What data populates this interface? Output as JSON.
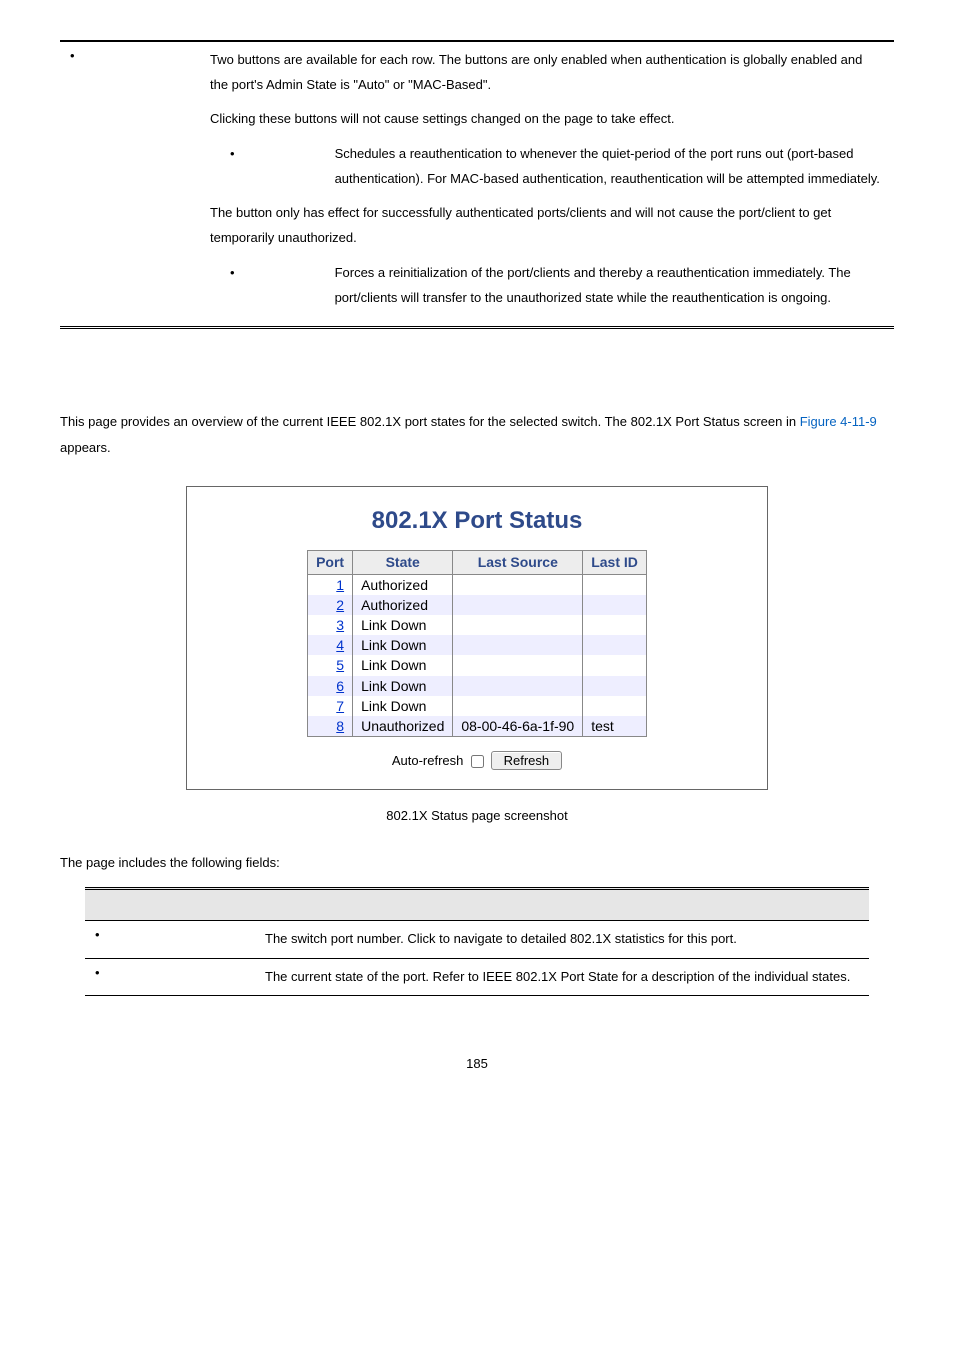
{
  "topTable": {
    "paragraphs": [
      "Two buttons are available for each row. The buttons are only enabled when authentication is globally enabled and the port's Admin State is \"Auto\" or \"MAC-Based\".",
      "Clicking these buttons will not cause settings changed on the page to take effect."
    ],
    "bullets1": [
      "Schedules a reauthentication to whenever the quiet-period of the port runs out (port-based authentication). For MAC-based authentication, reauthentication will be attempted immediately."
    ],
    "paragraphs2": [
      "The button only has effect for successfully authenticated ports/clients and will not cause the port/client to get temporarily unauthorized."
    ],
    "bullets2": [
      "Forces a reinitialization of the port/clients and thereby a reauthentication immediately. The port/clients will transfer to the unauthorized state while the reauthentication is ongoing."
    ]
  },
  "introText": {
    "part1": "This page provides an overview of the current IEEE 802.1X port states for the selected switch. The 802.1X Port Status screen in ",
    "linkText": "Figure 4-11-9",
    "part2": " appears."
  },
  "screenshot": {
    "title": "802.1X Port Status",
    "headers": {
      "port": "Port",
      "state": "State",
      "lastSource": "Last Source",
      "lastId": "Last ID"
    },
    "rows": [
      {
        "port": "1",
        "state": "Authorized",
        "lastSource": "",
        "lastId": ""
      },
      {
        "port": "2",
        "state": "Authorized",
        "lastSource": "",
        "lastId": ""
      },
      {
        "port": "3",
        "state": "Link Down",
        "lastSource": "",
        "lastId": ""
      },
      {
        "port": "4",
        "state": "Link Down",
        "lastSource": "",
        "lastId": ""
      },
      {
        "port": "5",
        "state": "Link Down",
        "lastSource": "",
        "lastId": ""
      },
      {
        "port": "6",
        "state": "Link Down",
        "lastSource": "",
        "lastId": ""
      },
      {
        "port": "7",
        "state": "Link Down",
        "lastSource": "",
        "lastId": ""
      },
      {
        "port": "8",
        "state": "Unauthorized",
        "lastSource": "08-00-46-6a-1f-90",
        "lastId": "test"
      }
    ],
    "autoRefreshLabel": "Auto-refresh",
    "refreshButton": "Refresh"
  },
  "figCaption": "802.1X Status page screenshot",
  "fieldsIntro": "The page includes the following fields:",
  "fieldsTable": [
    {
      "desc": "The switch port number. Click to navigate to detailed 802.1X statistics for this port."
    },
    {
      "desc": "The current state of the port. Refer to IEEE 802.1X Port State for a description of the individual states."
    }
  ],
  "pageNumber": "185"
}
